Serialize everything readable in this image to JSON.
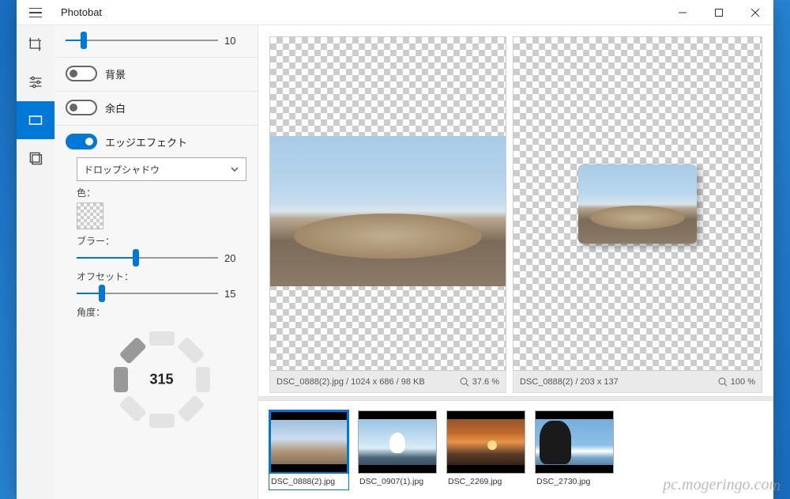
{
  "app": {
    "title": "Photobat"
  },
  "sidepanel": {
    "top_slider": {
      "value": 10,
      "pct": 12
    },
    "toggles": {
      "background": {
        "label": "背景",
        "on": false
      },
      "margin": {
        "label": "余白",
        "on": false
      },
      "edge": {
        "label": "エッジエフェクト",
        "on": true
      }
    },
    "edge": {
      "effect_select": "ドロップシャドウ",
      "color_label": "色：",
      "blur": {
        "label": "ブラー：",
        "value": 20,
        "pct": 42
      },
      "offset": {
        "label": "オフセット：",
        "value": 15,
        "pct": 18
      },
      "angle": {
        "label": "角度：",
        "value": 315
      }
    }
  },
  "preview": {
    "left": {
      "info": "DSC_0888(2).jpg / 1024 x 686 / 98 KB",
      "zoom": "37.6 %"
    },
    "right": {
      "info": "DSC_0888(2) / 203 x 137",
      "zoom": "100 %"
    }
  },
  "thumbs": [
    {
      "name": "DSC_0888(2).jpg",
      "selected": true,
      "cls": "tA"
    },
    {
      "name": "DSC_0907(1).jpg",
      "selected": false,
      "cls": "tB"
    },
    {
      "name": "DSC_2269.jpg",
      "selected": false,
      "cls": "tC"
    },
    {
      "name": "DSC_2730.jpg",
      "selected": false,
      "cls": "tD"
    }
  ],
  "watermark": "pc.mogeringo.com"
}
